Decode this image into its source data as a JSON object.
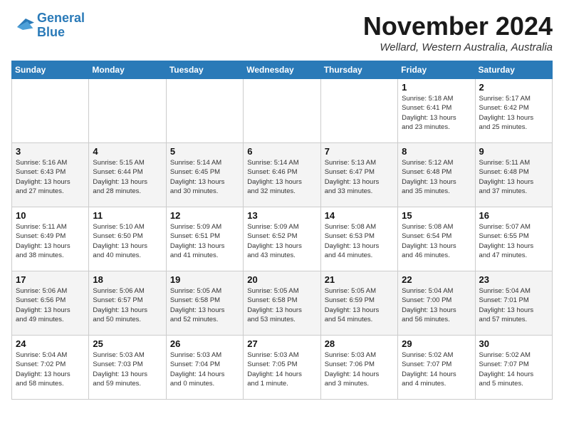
{
  "logo": {
    "line1": "General",
    "line2": "Blue"
  },
  "title": "November 2024",
  "subtitle": "Wellard, Western Australia, Australia",
  "days_header": [
    "Sunday",
    "Monday",
    "Tuesday",
    "Wednesday",
    "Thursday",
    "Friday",
    "Saturday"
  ],
  "weeks": [
    [
      {
        "day": "",
        "info": ""
      },
      {
        "day": "",
        "info": ""
      },
      {
        "day": "",
        "info": ""
      },
      {
        "day": "",
        "info": ""
      },
      {
        "day": "",
        "info": ""
      },
      {
        "day": "1",
        "info": "Sunrise: 5:18 AM\nSunset: 6:41 PM\nDaylight: 13 hours\nand 23 minutes."
      },
      {
        "day": "2",
        "info": "Sunrise: 5:17 AM\nSunset: 6:42 PM\nDaylight: 13 hours\nand 25 minutes."
      }
    ],
    [
      {
        "day": "3",
        "info": "Sunrise: 5:16 AM\nSunset: 6:43 PM\nDaylight: 13 hours\nand 27 minutes."
      },
      {
        "day": "4",
        "info": "Sunrise: 5:15 AM\nSunset: 6:44 PM\nDaylight: 13 hours\nand 28 minutes."
      },
      {
        "day": "5",
        "info": "Sunrise: 5:14 AM\nSunset: 6:45 PM\nDaylight: 13 hours\nand 30 minutes."
      },
      {
        "day": "6",
        "info": "Sunrise: 5:14 AM\nSunset: 6:46 PM\nDaylight: 13 hours\nand 32 minutes."
      },
      {
        "day": "7",
        "info": "Sunrise: 5:13 AM\nSunset: 6:47 PM\nDaylight: 13 hours\nand 33 minutes."
      },
      {
        "day": "8",
        "info": "Sunrise: 5:12 AM\nSunset: 6:48 PM\nDaylight: 13 hours\nand 35 minutes."
      },
      {
        "day": "9",
        "info": "Sunrise: 5:11 AM\nSunset: 6:48 PM\nDaylight: 13 hours\nand 37 minutes."
      }
    ],
    [
      {
        "day": "10",
        "info": "Sunrise: 5:11 AM\nSunset: 6:49 PM\nDaylight: 13 hours\nand 38 minutes."
      },
      {
        "day": "11",
        "info": "Sunrise: 5:10 AM\nSunset: 6:50 PM\nDaylight: 13 hours\nand 40 minutes."
      },
      {
        "day": "12",
        "info": "Sunrise: 5:09 AM\nSunset: 6:51 PM\nDaylight: 13 hours\nand 41 minutes."
      },
      {
        "day": "13",
        "info": "Sunrise: 5:09 AM\nSunset: 6:52 PM\nDaylight: 13 hours\nand 43 minutes."
      },
      {
        "day": "14",
        "info": "Sunrise: 5:08 AM\nSunset: 6:53 PM\nDaylight: 13 hours\nand 44 minutes."
      },
      {
        "day": "15",
        "info": "Sunrise: 5:08 AM\nSunset: 6:54 PM\nDaylight: 13 hours\nand 46 minutes."
      },
      {
        "day": "16",
        "info": "Sunrise: 5:07 AM\nSunset: 6:55 PM\nDaylight: 13 hours\nand 47 minutes."
      }
    ],
    [
      {
        "day": "17",
        "info": "Sunrise: 5:06 AM\nSunset: 6:56 PM\nDaylight: 13 hours\nand 49 minutes."
      },
      {
        "day": "18",
        "info": "Sunrise: 5:06 AM\nSunset: 6:57 PM\nDaylight: 13 hours\nand 50 minutes."
      },
      {
        "day": "19",
        "info": "Sunrise: 5:05 AM\nSunset: 6:58 PM\nDaylight: 13 hours\nand 52 minutes."
      },
      {
        "day": "20",
        "info": "Sunrise: 5:05 AM\nSunset: 6:58 PM\nDaylight: 13 hours\nand 53 minutes."
      },
      {
        "day": "21",
        "info": "Sunrise: 5:05 AM\nSunset: 6:59 PM\nDaylight: 13 hours\nand 54 minutes."
      },
      {
        "day": "22",
        "info": "Sunrise: 5:04 AM\nSunset: 7:00 PM\nDaylight: 13 hours\nand 56 minutes."
      },
      {
        "day": "23",
        "info": "Sunrise: 5:04 AM\nSunset: 7:01 PM\nDaylight: 13 hours\nand 57 minutes."
      }
    ],
    [
      {
        "day": "24",
        "info": "Sunrise: 5:04 AM\nSunset: 7:02 PM\nDaylight: 13 hours\nand 58 minutes."
      },
      {
        "day": "25",
        "info": "Sunrise: 5:03 AM\nSunset: 7:03 PM\nDaylight: 13 hours\nand 59 minutes."
      },
      {
        "day": "26",
        "info": "Sunrise: 5:03 AM\nSunset: 7:04 PM\nDaylight: 14 hours\nand 0 minutes."
      },
      {
        "day": "27",
        "info": "Sunrise: 5:03 AM\nSunset: 7:05 PM\nDaylight: 14 hours\nand 1 minute."
      },
      {
        "day": "28",
        "info": "Sunrise: 5:03 AM\nSunset: 7:06 PM\nDaylight: 14 hours\nand 3 minutes."
      },
      {
        "day": "29",
        "info": "Sunrise: 5:02 AM\nSunset: 7:07 PM\nDaylight: 14 hours\nand 4 minutes."
      },
      {
        "day": "30",
        "info": "Sunrise: 5:02 AM\nSunset: 7:07 PM\nDaylight: 14 hours\nand 5 minutes."
      }
    ]
  ]
}
